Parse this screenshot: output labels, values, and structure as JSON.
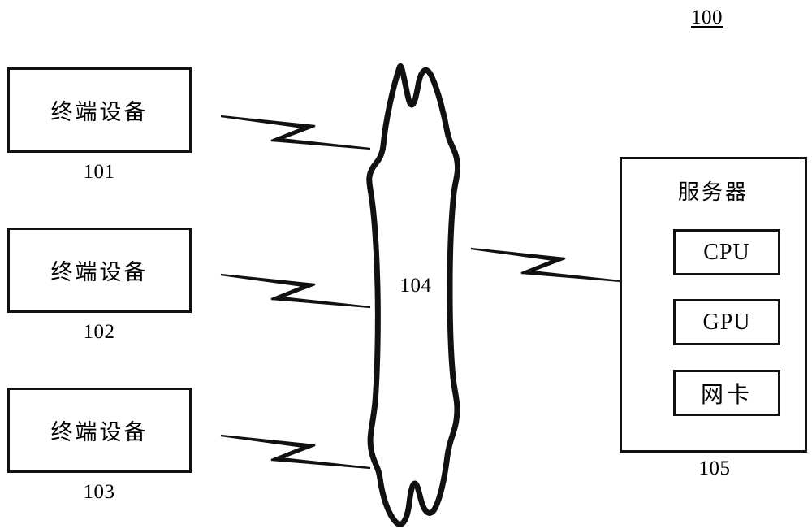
{
  "figure": {
    "number": "100"
  },
  "terminals": [
    {
      "label": "终端设备",
      "ref": "101"
    },
    {
      "label": "终端设备",
      "ref": "102"
    },
    {
      "label": "终端设备",
      "ref": "103"
    }
  ],
  "network": {
    "label": "104",
    "shape": "cloud"
  },
  "server": {
    "title": "服务器",
    "ref": "105",
    "units": [
      {
        "label": "CPU"
      },
      {
        "label": "GPU"
      },
      {
        "label": "网卡"
      }
    ]
  },
  "connectors": [
    {
      "name": "terminal-1-to-network",
      "icon": "lightning-bolt-icon"
    },
    {
      "name": "terminal-2-to-network",
      "icon": "lightning-bolt-icon"
    },
    {
      "name": "terminal-3-to-network",
      "icon": "lightning-bolt-icon"
    },
    {
      "name": "network-to-server",
      "icon": "lightning-bolt-icon"
    }
  ],
  "colors": {
    "stroke": "#111111",
    "background": "#ffffff"
  }
}
